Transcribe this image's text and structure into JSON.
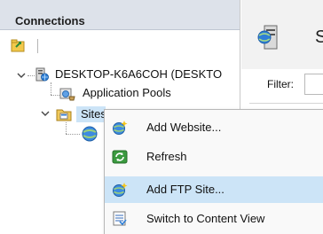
{
  "connections": {
    "title": "Connections",
    "toolbar": {
      "connect_icon": "connect-icon"
    },
    "tree": {
      "server": {
        "label": "DESKTOP-K6A6COH (DESKTO"
      },
      "app_pools": {
        "label": "Application Pools"
      },
      "sites": {
        "label": "Sites"
      }
    }
  },
  "right_pane": {
    "title_initial": "S",
    "filter_label": "Filter:"
  },
  "context_menu": {
    "items": [
      {
        "label": "Add Website...",
        "icon": "globe-add-icon"
      },
      {
        "label": "Refresh",
        "icon": "refresh-icon"
      },
      {
        "label": "Add FTP Site...",
        "icon": "ftp-add-icon",
        "highlighted": true
      },
      {
        "label": "Switch to Content View",
        "icon": "content-view-icon"
      }
    ]
  }
}
